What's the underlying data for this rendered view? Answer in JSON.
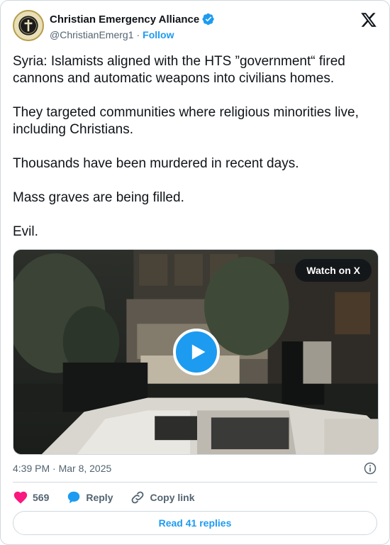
{
  "author": {
    "display_name": "Christian Emergency Alliance",
    "handle": "@ChristianEmerg1",
    "separator": "·",
    "follow_label": "Follow",
    "avatar_text": "CHRISTIAN EMERGENCY ALLIANCE",
    "verified": true
  },
  "tweet": {
    "paragraphs": [
      "Syria: Islamists aligned with the HTS ”government“ fired cannons and automatic weapons into civilians homes.",
      "They targeted communities where religious minorities live, including Christians.",
      "Thousands have been murdered in recent days.",
      "Mass graves are being filled.",
      "Evil."
    ]
  },
  "media": {
    "watch_label": "Watch on X",
    "play_icon": "play-icon"
  },
  "meta": {
    "timestamp": "4:39 PM · Mar 8, 2025",
    "info_icon": "info-icon"
  },
  "actions": {
    "likes": "569",
    "reply_label": "Reply",
    "copy_link_label": "Copy link"
  },
  "read_replies_label": "Read 41 replies",
  "colors": {
    "accent": "#1d9bf0",
    "like": "#f91880",
    "muted": "#536471",
    "text": "#0f1419",
    "border": "#cfd9de"
  }
}
